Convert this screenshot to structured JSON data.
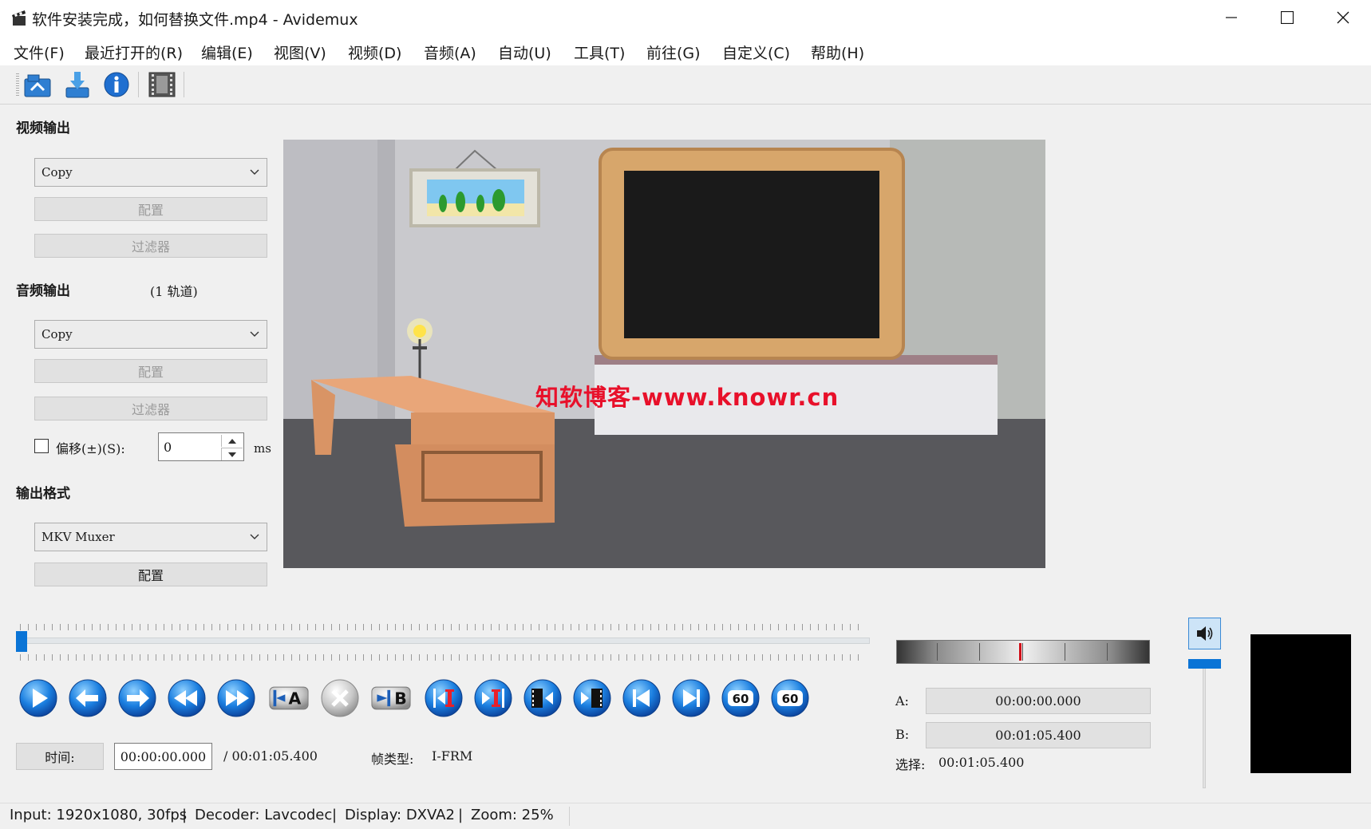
{
  "window": {
    "title": "软件安装完成，如何替换文件.mp4 - Avidemux",
    "minimize_icon": "minimize-icon",
    "maximize_icon": "maximize-icon",
    "close_icon": "close-icon"
  },
  "menu": [
    "文件(F)",
    "最近打开的(R)",
    "编辑(E)",
    "视图(V)",
    "视频(D)",
    "音频(A)",
    "自动(U)",
    "工具(T)",
    "前往(G)",
    "自定义(C)",
    "帮助(H)"
  ],
  "toolbar": {
    "open_icon": "open-folder-icon",
    "save_icon": "save-download-icon",
    "info_icon": "info-icon",
    "film_icon": "film-strip-icon"
  },
  "video_output": {
    "label": "视频输出",
    "codec": "Copy",
    "configure": "配置",
    "filters": "过滤器"
  },
  "audio_output": {
    "label": "音频输出",
    "tracks": "(1 轨道)",
    "codec": "Copy",
    "configure": "配置",
    "filters": "过滤器",
    "shift_label": "偏移(±)(S):",
    "shift_value": "0",
    "shift_unit": "ms",
    "shift_checked": false
  },
  "output_format": {
    "label": "输出格式",
    "muxer": "MKV Muxer",
    "configure": "配置"
  },
  "preview": {
    "watermark": "知软博客-www.knowr.cn"
  },
  "playback": {
    "position": 0.0,
    "buttons": [
      "play-icon",
      "previous-frame-icon",
      "next-frame-icon",
      "rewind-icon",
      "fast-forward-icon",
      "set-marker-a-icon",
      "clear-markers-icon",
      "set-marker-b-icon",
      "previous-intra-frame-icon",
      "next-intra-frame-icon",
      "previous-black-frame-icon",
      "next-black-frame-icon",
      "go-to-start-icon",
      "go-to-end-icon",
      "back-60-icon",
      "forward-60-icon"
    ],
    "marker_a_text": "A",
    "marker_b_text": "B",
    "back60_text": "60",
    "forward60_text": "60"
  },
  "time": {
    "button": "时间:",
    "current": "00:00:00.000",
    "total": "/ 00:01:05.400",
    "frame_type_label": "帧类型:",
    "frame_type": "I-FRM"
  },
  "selection": {
    "a_label": "A:",
    "a_value": "00:00:00.000",
    "b_label": "B:",
    "b_value": "00:01:05.400",
    "select_label": "选择:",
    "select_value": "00:01:05.400"
  },
  "volume": {
    "icon": "speaker-icon",
    "level": 1.0
  },
  "status": {
    "input": "Input: 1920x1080, 30fps",
    "sep": "|",
    "decoder": "Decoder: Lavcodec",
    "display": "Display: DXVA2",
    "zoom": "Zoom: 25%"
  }
}
